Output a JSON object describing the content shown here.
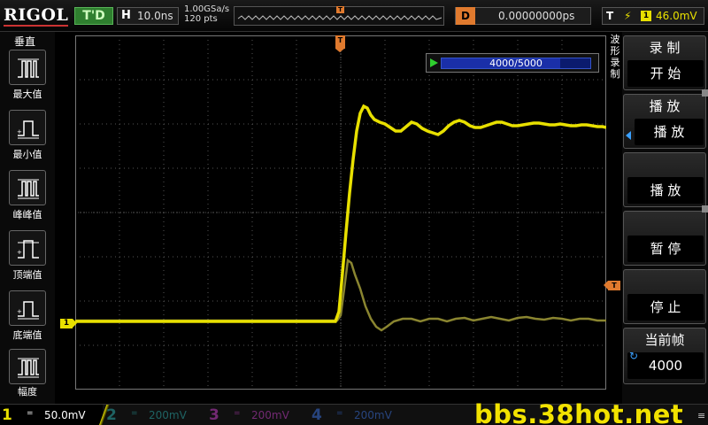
{
  "brand": "RIGOL",
  "status": "T'D",
  "timebase": {
    "label": "H",
    "value": "10.0ns"
  },
  "sample": {
    "rate": "1.00GSa/s",
    "points": "120 pts"
  },
  "memory": {
    "trigger_marker": "T"
  },
  "delay": {
    "label": "D",
    "value": "0.00000000ps"
  },
  "trigger": {
    "label": "T",
    "edge_icon": "rising-edge-icon",
    "source": "1",
    "level": "46.0mV"
  },
  "left_panel": {
    "title": "垂直",
    "items": [
      {
        "label": "最大值",
        "icon": "max-measure-icon"
      },
      {
        "label": "最小值",
        "icon": "min-measure-icon"
      },
      {
        "label": "峰峰值",
        "icon": "peak-to-peak-icon"
      },
      {
        "label": "顶端值",
        "icon": "top-value-icon"
      },
      {
        "label": "底端值",
        "icon": "base-value-icon"
      },
      {
        "label": "幅度",
        "icon": "amplitude-icon"
      }
    ]
  },
  "frame": {
    "text": "4000/5000",
    "current": 4000,
    "total": 5000
  },
  "side_label": "波形录制",
  "markers": {
    "ch1": "1",
    "trigger_pos": "T",
    "trigger_level": "T"
  },
  "right_menu": {
    "record": {
      "title": "录 制",
      "value": "开 始"
    },
    "playback": {
      "title": "播 放",
      "value": "播 放"
    },
    "play": {
      "value": "播 放"
    },
    "pause": {
      "value": "暂 停"
    },
    "stop": {
      "value": "停 止"
    },
    "current_frame": {
      "title": "当前帧",
      "value": "4000"
    }
  },
  "channels": [
    {
      "num": "1",
      "coupling": "=",
      "scale": "50.0mV",
      "color": "#e8e000",
      "active": true
    },
    {
      "num": "2",
      "coupling": "=",
      "scale": "200mV",
      "color": "#2aa6a6",
      "active": false
    },
    {
      "num": "3",
      "coupling": "=",
      "scale": "200mV",
      "color": "#c23ec2",
      "active": false
    },
    {
      "num": "4",
      "coupling": "=",
      "scale": "200mV",
      "color": "#3b6fd8",
      "active": false
    }
  ],
  "watermark": "bbs.38hot.net",
  "colors": {
    "ch1": "#e8e000",
    "trigger": "#e07a2e",
    "grid": "#555555",
    "frame_bar": "#1a2fa8"
  }
}
